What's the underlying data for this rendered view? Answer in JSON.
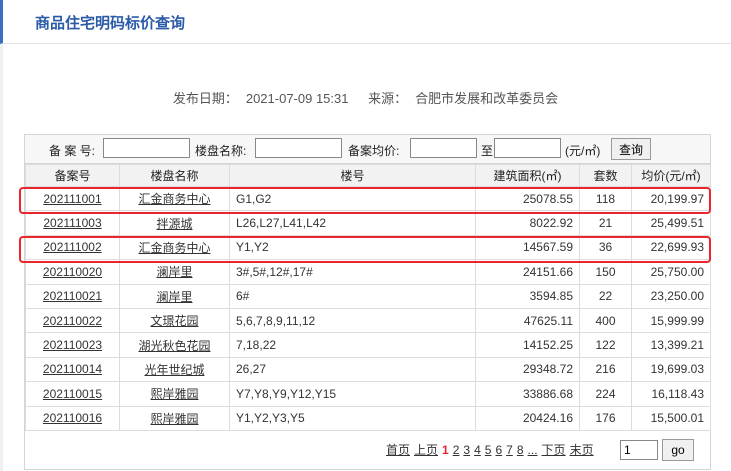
{
  "header": {
    "title": "商品住宅明码标价查询"
  },
  "meta": {
    "date_label": "发布日期：",
    "date_value": "2021-07-09 15:31",
    "source_label": "来源：",
    "source_value": "合肥市发展和改革委员会"
  },
  "search": {
    "record_no_label": "备 案 号:",
    "name_label": "楼盘名称:",
    "price_label": "备案均价:",
    "to_label": "至",
    "unit_label": "(元/㎡)",
    "query_button": "查询",
    "record_no_value": "",
    "name_value": "",
    "price_from_value": "",
    "price_to_value": ""
  },
  "table": {
    "headers": [
      "备案号",
      "楼盘名称",
      "楼号",
      "建筑面积(㎡)",
      "套数",
      "均价(元/㎡)"
    ],
    "rows": [
      [
        "202111001",
        "汇金商务中心",
        "G1,G2",
        "25078.55",
        "118",
        "20,199.97"
      ],
      [
        "202111003",
        "拌源城",
        "L26,L27,L41,L42",
        "8022.92",
        "21",
        "25,499.51"
      ],
      [
        "202111002",
        "汇金商务中心",
        "Y1,Y2",
        "14567.59",
        "36",
        "22,699.93"
      ],
      [
        "202110020",
        "澜岸里",
        "3#,5#,12#,17#",
        "24151.66",
        "150",
        "25,750.00"
      ],
      [
        "202110021",
        "澜岸里",
        "6#",
        "3594.85",
        "22",
        "23,250.00"
      ],
      [
        "202110022",
        "文璟花园",
        "5,6,7,8,9,11,12",
        "47625.11",
        "400",
        "15,999.99"
      ],
      [
        "202110023",
        "湖光秋色花园",
        "7,18,22",
        "14152.25",
        "122",
        "13,399.21"
      ],
      [
        "202110014",
        "光年世纪城",
        "26,27",
        "29348.72",
        "216",
        "19,699.03"
      ],
      [
        "202110015",
        "熙岸雅园",
        "Y7,Y8,Y9,Y12,Y15",
        "33886.68",
        "224",
        "16,118.43"
      ],
      [
        "202110016",
        "熙岸雅园",
        "Y1,Y2,Y3,Y5",
        "20424.16",
        "176",
        "15,500.01"
      ]
    ]
  },
  "pager": {
    "first": "首页",
    "prev": "上页",
    "current": "1",
    "pages": [
      "2",
      "3",
      "4",
      "5",
      "6",
      "7",
      "8"
    ],
    "ellipsis": "...",
    "next": "下页",
    "last": "末页",
    "goto_value": "1",
    "go_button": "go"
  },
  "colors": {
    "accent": "#2b5aa8",
    "highlight": "#e8262b"
  }
}
